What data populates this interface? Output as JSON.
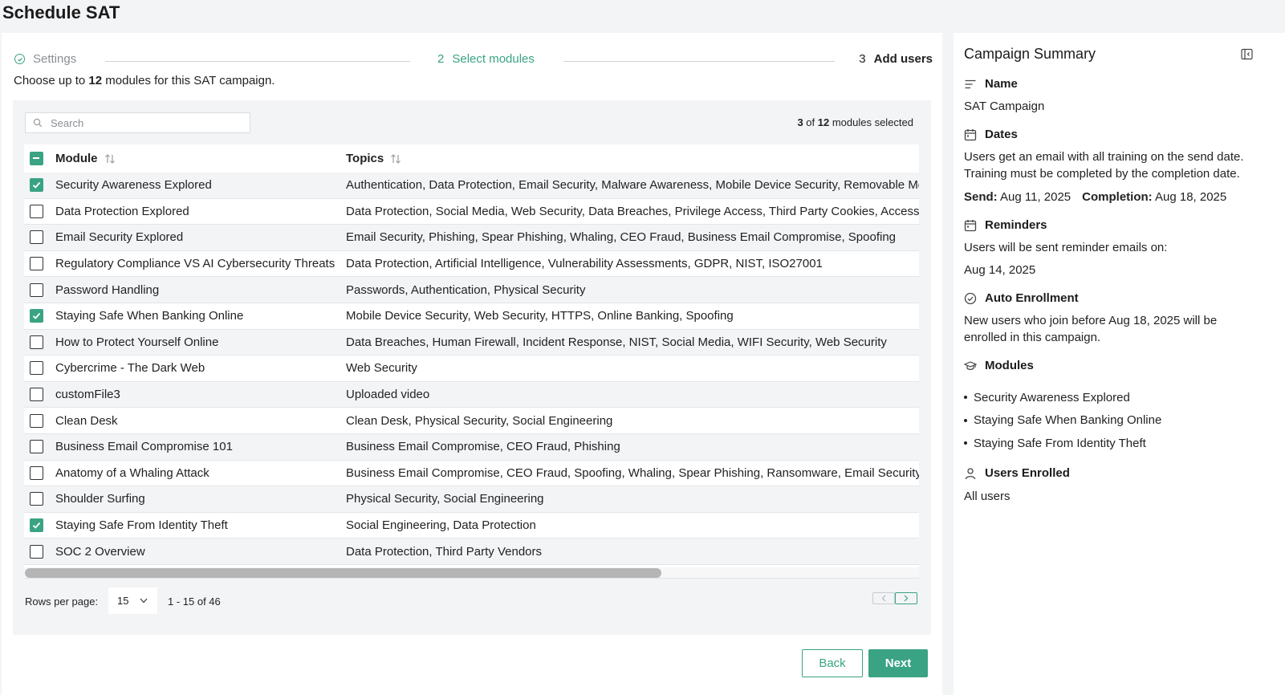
{
  "page": {
    "title": "Schedule SAT"
  },
  "stepper": {
    "step1_label": "Settings",
    "step2_num": "2",
    "step2_label": "Select modules",
    "step3_num": "3",
    "step3_label": "Add users"
  },
  "intro": {
    "prefix": "Choose up to ",
    "max": "12",
    "suffix": " modules for this SAT campaign."
  },
  "search": {
    "placeholder": "Search",
    "value": ""
  },
  "selection": {
    "count": "3",
    "of": " of ",
    "max": "12",
    "suffix": " modules selected"
  },
  "table": {
    "columns": {
      "module": "Module",
      "topics": "Topics"
    },
    "rows": [
      {
        "module": "Security Awareness Explored",
        "topics": "Authentication, Data Protection, Email Security, Malware Awareness, Mobile Device Security, Removable Media",
        "checked": true
      },
      {
        "module": "Data Protection Explored",
        "topics": "Data Protection, Social Media, Web Security, Data Breaches, Privilege Access, Third Party Cookies, Access Control",
        "checked": false
      },
      {
        "module": "Email Security Explored",
        "topics": "Email Security, Phishing, Spear Phishing, Whaling, CEO Fraud, Business Email Compromise, Spoofing",
        "checked": false
      },
      {
        "module": "Regulatory Compliance VS AI Cybersecurity Threats",
        "topics": "Data Protection, Artificial Intelligence, Vulnerability Assessments, GDPR, NIST, ISO27001",
        "checked": false
      },
      {
        "module": "Password Handling",
        "topics": "Passwords, Authentication, Physical Security",
        "checked": false
      },
      {
        "module": "Staying Safe When Banking Online",
        "topics": "Mobile Device Security, Web Security, HTTPS, Online Banking, Spoofing",
        "checked": true
      },
      {
        "module": "How to Protect Yourself Online",
        "topics": "Data Breaches, Human Firewall, Incident Response, NIST, Social Media, WIFI Security, Web Security",
        "checked": false
      },
      {
        "module": "Cybercrime - The Dark Web",
        "topics": "Web Security",
        "checked": false
      },
      {
        "module": "customFile3",
        "topics": "Uploaded video",
        "checked": false
      },
      {
        "module": "Clean Desk",
        "topics": "Clean Desk, Physical Security, Social Engineering",
        "checked": false
      },
      {
        "module": "Business Email Compromise 101",
        "topics": "Business Email Compromise, CEO Fraud, Phishing",
        "checked": false
      },
      {
        "module": "Anatomy of a Whaling Attack",
        "topics": "Business Email Compromise, CEO Fraud, Spoofing, Whaling, Spear Phishing, Ransomware, Email Security",
        "checked": false
      },
      {
        "module": "Shoulder Surfing",
        "topics": "Physical Security, Social Engineering",
        "checked": false
      },
      {
        "module": "Staying Safe From Identity Theft",
        "topics": "Social Engineering, Data Protection",
        "checked": true
      },
      {
        "module": "SOC 2 Overview",
        "topics": "Data Protection, Third Party Vendors",
        "checked": false
      }
    ]
  },
  "pagination": {
    "rows_label": "Rows per page:",
    "rows_value": "15",
    "range": "1 - 15 of 46"
  },
  "buttons": {
    "back": "Back",
    "next": "Next"
  },
  "summary": {
    "title": "Campaign Summary",
    "name_h": "Name",
    "name_v": "SAT Campaign",
    "dates_h": "Dates",
    "dates_line1": "Users get an email with all training on the send date.",
    "dates_line2": "Training must be completed by the completion date.",
    "send_label": "Send:",
    "send_value": " Aug 11, 2025",
    "completion_label": "Completion:",
    "completion_value": " Aug 18, 2025",
    "reminders_h": "Reminders",
    "reminders_text": "Users will be sent reminder emails on:",
    "reminders_date": "Aug 14, 2025",
    "auto_h": "Auto Enrollment",
    "auto_line1": "New users who join before Aug 18, 2025 will be",
    "auto_line2": "enrolled in this campaign.",
    "modules_h": "Modules",
    "modules": [
      "Security Awareness Explored",
      "Staying Safe When Banking Online",
      "Staying Safe From Identity Theft"
    ],
    "users_h": "Users Enrolled",
    "users_v": "All users"
  },
  "colors": {
    "accent": "#3aa384",
    "background": "#f3f4f6",
    "text": "#222222"
  },
  "icons": {
    "step1": "check-circle-icon",
    "search": "search-icon",
    "sort": "sort-arrows-icon",
    "dropdown": "chevron-down-icon",
    "prev": "chevron-left-icon",
    "next": "chevron-right-icon",
    "collapse": "panel-collapse-icon",
    "name": "text-lines-icon",
    "dates": "calendar-icon",
    "reminders": "calendar-icon",
    "auto": "check-circle-icon",
    "modules": "graduation-cap-icon",
    "users": "user-icon"
  }
}
